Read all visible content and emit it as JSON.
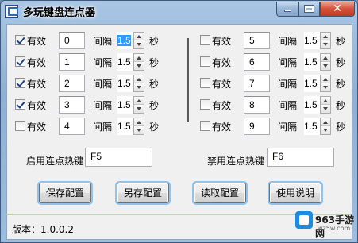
{
  "window": {
    "title": "多玩键盘连点器"
  },
  "labels": {
    "enable": "有效",
    "interval": "间隔",
    "seconds": "秒"
  },
  "rows": [
    {
      "checked": true,
      "key": "0",
      "interval": "1.5"
    },
    {
      "checked": true,
      "key": "1",
      "interval": "1.5"
    },
    {
      "checked": true,
      "key": "2",
      "interval": "1.5"
    },
    {
      "checked": true,
      "key": "3",
      "interval": "1.5"
    },
    {
      "checked": false,
      "key": "4",
      "interval": "1.5"
    },
    {
      "checked": false,
      "key": "5",
      "interval": "1.5"
    },
    {
      "checked": false,
      "key": "6",
      "interval": "1.5"
    },
    {
      "checked": false,
      "key": "7",
      "interval": "1.5"
    },
    {
      "checked": false,
      "key": "8",
      "interval": "1.5"
    },
    {
      "checked": false,
      "key": "9",
      "interval": "1.5"
    }
  ],
  "hotkeys": {
    "enable_label": "启用连点热键",
    "enable_value": "F5",
    "disable_label": "禁用连点热键",
    "disable_value": "F6"
  },
  "buttons": {
    "save": "保存配置",
    "load_as": "另存配置",
    "read": "读取配置",
    "help": "使用说明"
  },
  "status": {
    "version": "版本：1.0.0.2"
  },
  "watermark": {
    "site": "963手游网",
    "sub": "wz5w.com"
  }
}
